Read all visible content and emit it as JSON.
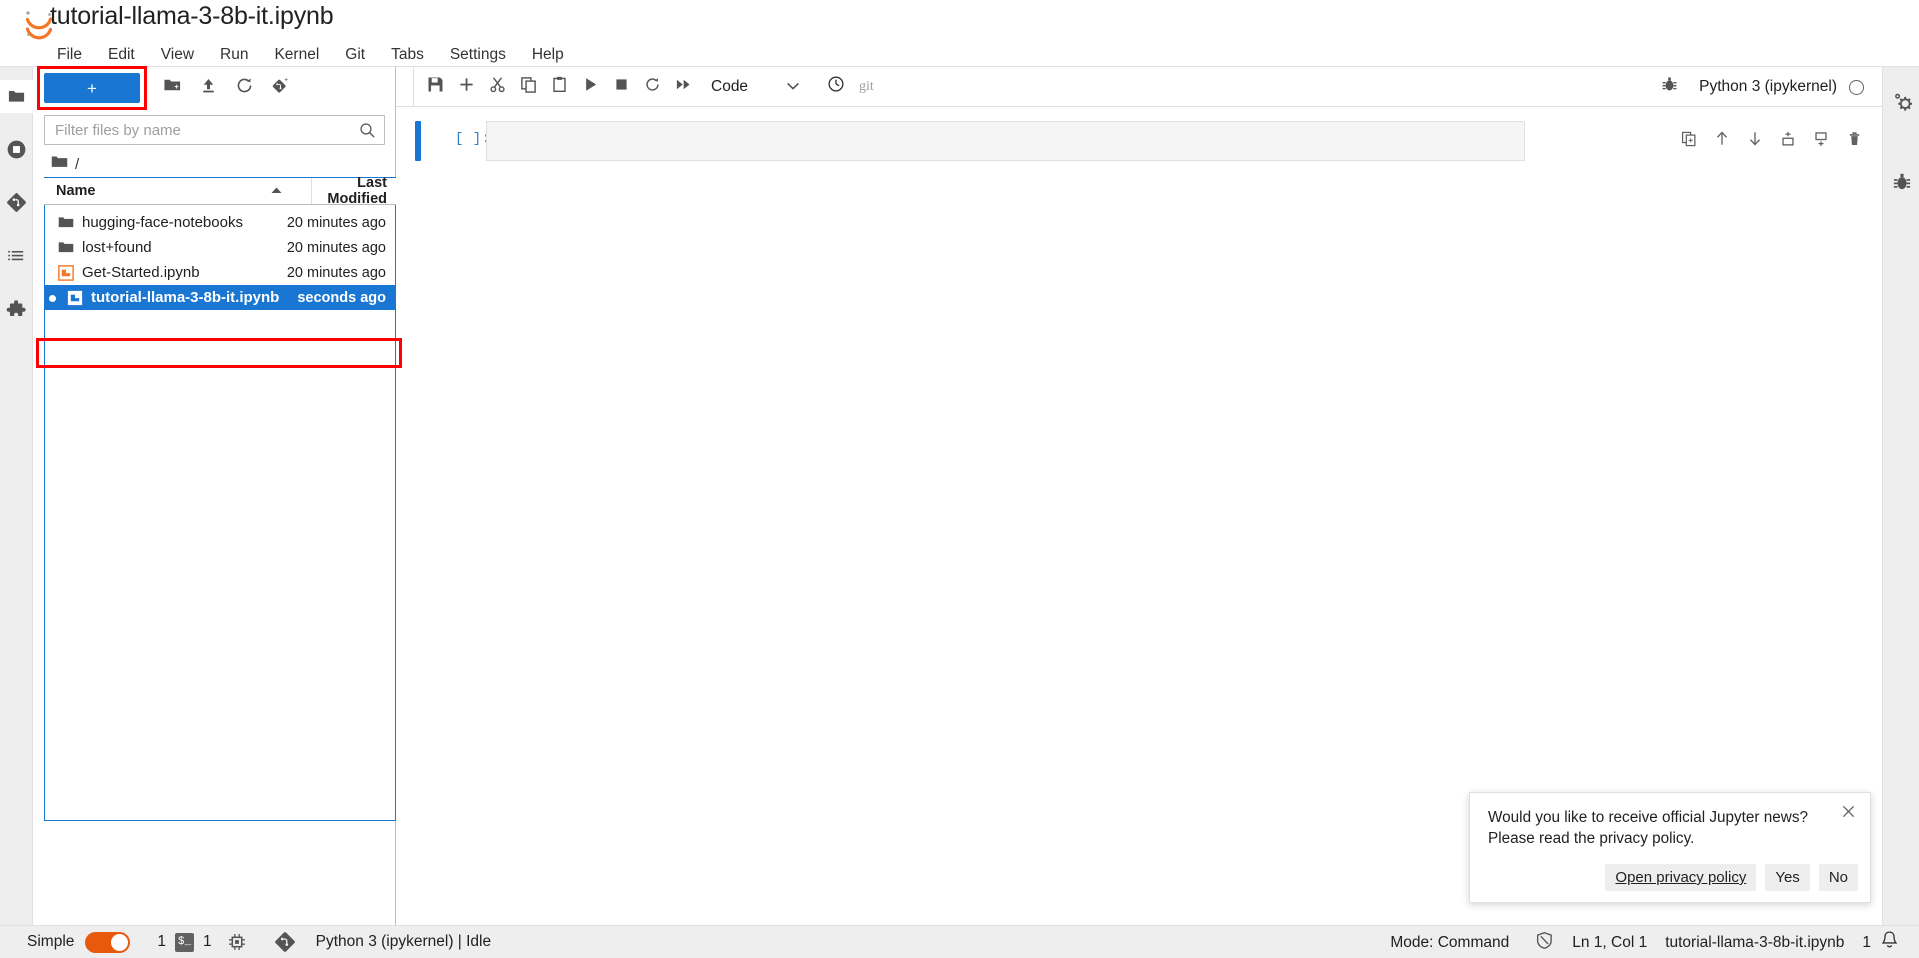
{
  "window": {
    "title": "tutorial-llama-3-8b-it.ipynb",
    "logo_icon": "jupyter-logo-icon"
  },
  "menubar": {
    "items": [
      {
        "label": "File",
        "name": "menu-file"
      },
      {
        "label": "Edit",
        "name": "menu-edit"
      },
      {
        "label": "View",
        "name": "menu-view"
      },
      {
        "label": "Run",
        "name": "menu-run"
      },
      {
        "label": "Kernel",
        "name": "menu-kernel"
      },
      {
        "label": "Git",
        "name": "menu-git"
      },
      {
        "label": "Tabs",
        "name": "menu-tabs"
      },
      {
        "label": "Settings",
        "name": "menu-settings"
      },
      {
        "label": "Help",
        "name": "menu-help"
      }
    ]
  },
  "left_sidebar": {
    "items": [
      {
        "name": "file-browser-icon",
        "label": "File Browser",
        "active": true
      },
      {
        "name": "running-terminals-icon",
        "label": "Running Terminals and Kernels",
        "active": false
      },
      {
        "name": "git-icon",
        "label": "Git",
        "active": false
      },
      {
        "name": "table-of-contents-icon",
        "label": "Table of Contents",
        "active": false
      },
      {
        "name": "extension-manager-icon",
        "label": "Extension Manager",
        "active": false
      }
    ]
  },
  "right_sidebar": {
    "items": [
      {
        "name": "property-inspector-icon",
        "label": "Property Inspector"
      },
      {
        "name": "debugger-icon",
        "label": "Debugger"
      }
    ]
  },
  "file_browser": {
    "new_launcher_label": "+",
    "toolbar_icons": [
      {
        "name": "new-folder-icon",
        "label": "New Folder"
      },
      {
        "name": "upload-icon",
        "label": "Upload Files"
      },
      {
        "name": "refresh-icon",
        "label": "Refresh File List"
      },
      {
        "name": "git-clone-icon",
        "label": "Git Clone"
      }
    ],
    "filter_placeholder": "Filter files by name",
    "filter_value": "",
    "breadcrumb_root": "/",
    "columns": {
      "name": "Name",
      "last_modified": "Last Modified"
    },
    "sort_direction": "ascending",
    "rows": [
      {
        "name": "hugging-face-notebooks",
        "modified": "20 minutes ago",
        "icon": "folder-icon",
        "selected": false,
        "dirty": false
      },
      {
        "name": "lost+found",
        "modified": "20 minutes ago",
        "icon": "folder-icon",
        "selected": false,
        "dirty": false
      },
      {
        "name": "Get-Started.ipynb",
        "modified": "20 minutes ago",
        "icon": "notebook-icon",
        "selected": false,
        "dirty": false
      },
      {
        "name": "tutorial-llama-3-8b-it.ipynb",
        "modified": "seconds ago",
        "icon": "notebook-icon",
        "selected": true,
        "dirty": true
      }
    ]
  },
  "notebook": {
    "toolbar_icons": [
      {
        "name": "save-icon",
        "label": "Save and create checkpoint"
      },
      {
        "name": "insert-cell-icon",
        "label": "Insert a cell below"
      },
      {
        "name": "cut-icon",
        "label": "Cut this cell"
      },
      {
        "name": "copy-icon",
        "label": "Copy this cell"
      },
      {
        "name": "paste-icon",
        "label": "Paste this cell from the clipboard"
      },
      {
        "name": "run-icon",
        "label": "Run this cell and advance"
      },
      {
        "name": "stop-icon",
        "label": "Interrupt the kernel"
      },
      {
        "name": "restart-icon",
        "label": "Restart the kernel"
      },
      {
        "name": "restart-run-all-icon",
        "label": "Restart the kernel and run all cells"
      }
    ],
    "cell_type": "Code",
    "cell_type_caret": "chevron-down-icon",
    "history_icon": "clock-icon",
    "git_label": "git",
    "kernel_indicator_icon": "debugger-bug-icon",
    "kernel_name": "Python 3 (ipykernel)",
    "kernel_status": "idle",
    "cell": {
      "prompt": "[ ]:",
      "source": "",
      "toolbar_icons": [
        {
          "name": "duplicate-cell-icon",
          "label": "Duplicate this cell"
        },
        {
          "name": "move-cell-up-icon",
          "label": "Move this cell up"
        },
        {
          "name": "move-cell-down-icon",
          "label": "Move this cell down"
        },
        {
          "name": "insert-cell-above-icon",
          "label": "Insert a cell above"
        },
        {
          "name": "insert-cell-below-icon",
          "label": "Insert a cell below"
        },
        {
          "name": "delete-cell-icon",
          "label": "Delete this cell"
        }
      ]
    }
  },
  "status_bar": {
    "simple_label": "Simple",
    "simple_enabled": true,
    "kernel_count": "1",
    "terminal_badge": "$_",
    "terminal_count": "1",
    "kernel_icon": "cpu-icon",
    "git_icon": "git-icon",
    "kernel_status_text": "Python 3 (ipykernel) | Idle",
    "mode_text": "Mode: Command",
    "shield_icon": "no-shield-icon",
    "cursor_position": "Ln 1, Col 1",
    "file_name": "tutorial-llama-3-8b-it.ipynb",
    "notification_count": "1",
    "bell_icon": "bell-icon"
  },
  "toast": {
    "message": "Would you like to receive official Jupyter news?\nPlease read the privacy policy.",
    "close_icon": "close-icon",
    "buttons": [
      {
        "label": "Open privacy policy",
        "name": "open-privacy-policy-button",
        "link": true
      },
      {
        "label": "Yes",
        "name": "toast-yes-button",
        "link": false
      },
      {
        "label": "No",
        "name": "toast-no-button",
        "link": false
      }
    ]
  },
  "colors": {
    "accent_blue": "#1976d2",
    "highlight_red": "#ff0000",
    "jupyter_orange": "#e8590c"
  }
}
